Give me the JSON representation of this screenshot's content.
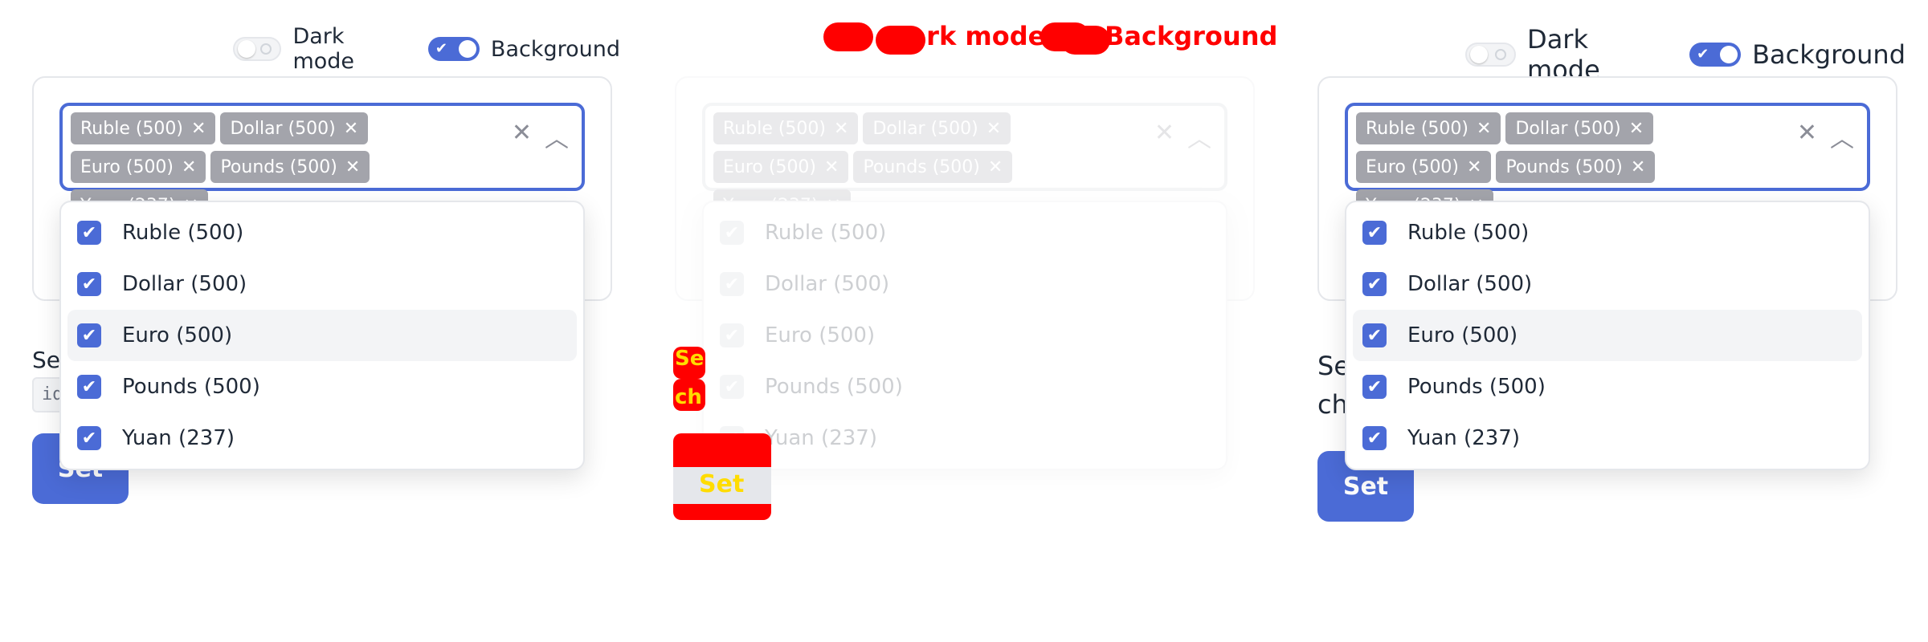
{
  "toggles": {
    "dark_mode_label": "Dark mode",
    "background_label": "Background"
  },
  "chips": [
    {
      "label": "Ruble (500)"
    },
    {
      "label": "Dollar (500)"
    },
    {
      "label": "Euro (500)"
    },
    {
      "label": "Pounds (500)"
    },
    {
      "label": "Yuan (237)"
    }
  ],
  "options": [
    {
      "label": "Ruble (500)",
      "checked": true
    },
    {
      "label": "Dollar (500)",
      "checked": true
    },
    {
      "label": "Euro (500)",
      "checked": true,
      "highlighted": true
    },
    {
      "label": "Pounds (500)",
      "checked": true
    },
    {
      "label": "Yuan (237)",
      "checked": true
    }
  ],
  "below": {
    "set_label_left": "Set",
    "code_snippet_left": "id",
    "set_label_middle": "Se",
    "set_label_middle_2": "ch",
    "set_label_right": "Se",
    "set_label_right_2": "ch",
    "set_button": "Set"
  },
  "colors": {
    "accent": "#4b6bd6",
    "chip": "#a3a4ab",
    "highlight_red": "#ff0000",
    "highlight_yellow": "#ffdc00"
  },
  "icons": {
    "remove_chip": "close-icon",
    "clear": "close-icon",
    "chevron": "chevron-up-icon",
    "checkbox": "check-icon"
  }
}
